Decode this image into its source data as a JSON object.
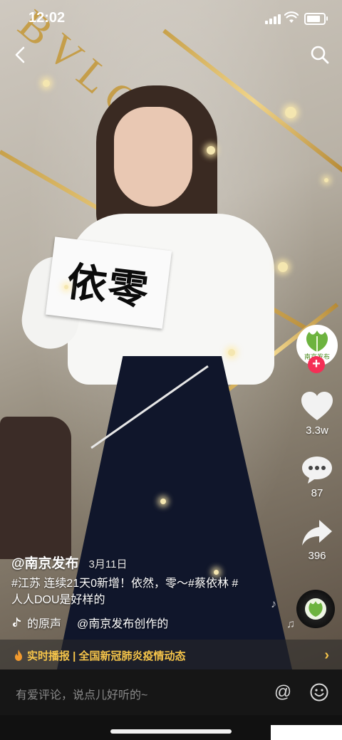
{
  "status_bar": {
    "time": "12:02"
  },
  "video": {
    "sign_text": "依零",
    "background_logo": "BVLG"
  },
  "right_rail": {
    "avatar_caption": "南京发布",
    "follow_symbol": "+",
    "like_count": "3.3w",
    "comment_count": "87",
    "share_count": "396"
  },
  "caption": {
    "author": "@南京发布",
    "date": "3月11日",
    "description_line1": "#江苏 连续21天0新增！依然，零～#蔡依林 #",
    "description_line2": "人人DOU是好样的",
    "music_original": "的原声",
    "music_creator": "@南京发布创作的"
  },
  "news_bar": {
    "text": "实时播报 | 全国新冠肺炎疫情动态",
    "chevron": "›"
  },
  "comment_bar": {
    "placeholder": "有爱评论，说点儿好听的~",
    "at_symbol": "@"
  },
  "icons": [
    "back-icon",
    "search-icon",
    "heart-icon",
    "comment-icon",
    "share-icon",
    "music-disc-icon",
    "tiktok-note-icon",
    "fire-icon",
    "emoji-icon"
  ],
  "colors": {
    "accent_red": "#f42f56",
    "news_yellow": "#f6c54a",
    "comment_bar_bg": "#161616"
  }
}
